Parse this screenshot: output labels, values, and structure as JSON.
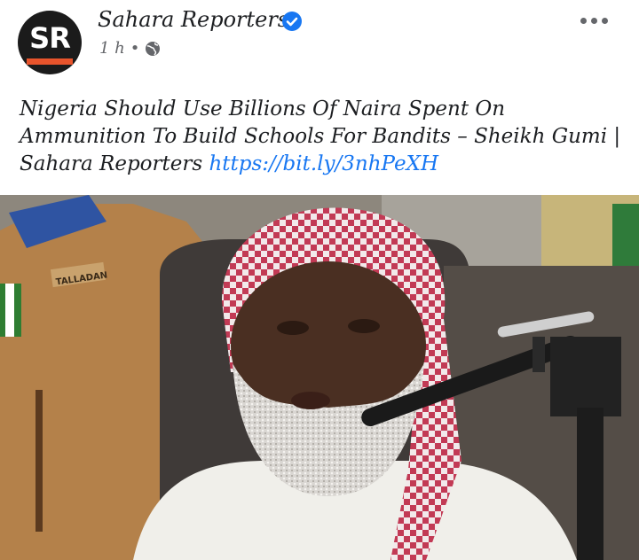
{
  "post": {
    "author": "Sahara Reporters",
    "avatar_text": "SR",
    "time": "1 h",
    "separator": "•",
    "headline": "Nigeria Should Use Billions Of Naira Spent On Ammunition To Build Schools For Bandits – Sheikh Gumi | Sahara Reporters",
    "link_text": "https://bit.ly/3nhPeXH",
    "icons": [
      "verified-badge-icon",
      "globe-icon",
      "more-options-icon"
    ],
    "colors": {
      "link": "#1877f2",
      "verified": "#1877f2",
      "meta": "#65676b",
      "avatar_stripe": "#e8542c"
    },
    "photo_badge_text": "TALLADAN"
  }
}
